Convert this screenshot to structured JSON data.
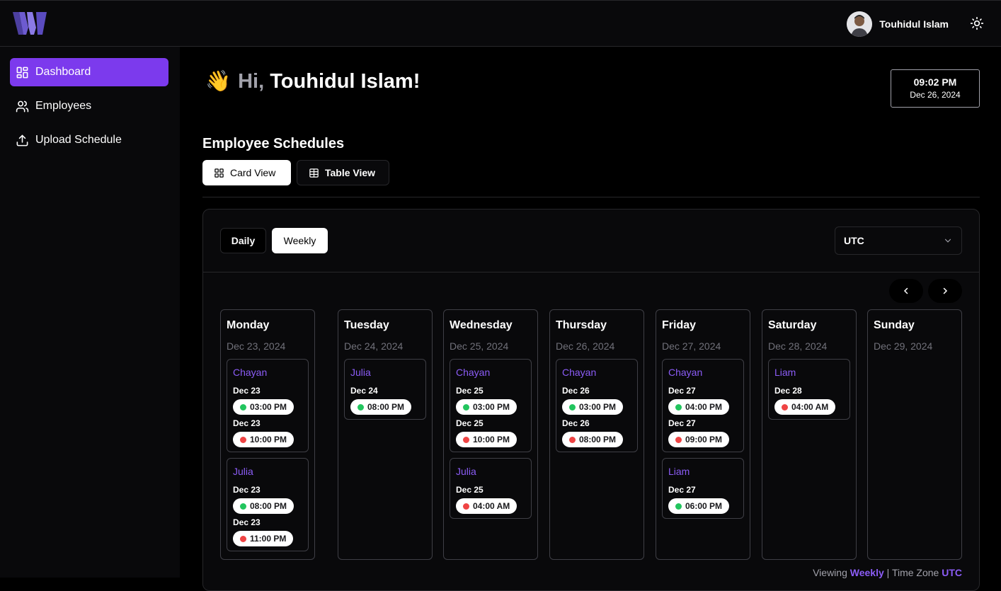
{
  "header": {
    "user_name": "Touhidul Islam",
    "theme_icon": "sun-icon"
  },
  "sidebar": {
    "items": [
      {
        "label": "Dashboard",
        "icon": "dashboard-icon",
        "active": true
      },
      {
        "label": "Employees",
        "icon": "users-icon",
        "active": false
      },
      {
        "label": "Upload Schedule",
        "icon": "upload-icon",
        "active": false
      }
    ]
  },
  "greeting": {
    "emoji": "👋",
    "hi": "Hi,",
    "name": "Touhidul Islam!"
  },
  "clock": {
    "time": "09:02 PM",
    "date": "Dec 26, 2024"
  },
  "schedules": {
    "title": "Employee Schedules",
    "card_view_label": "Card View",
    "table_view_label": "Table View",
    "daily_label": "Daily",
    "weekly_label": "Weekly",
    "timezone": "UTC",
    "footer": {
      "viewing": "Viewing",
      "mode": "Weekly",
      "separator": "|",
      "tz_label": "Time Zone",
      "tz": "UTC"
    },
    "days": [
      {
        "name": "Monday",
        "date": "Dec 23, 2024",
        "employees": [
          {
            "name": "Chayan",
            "shifts": [
              {
                "date": "Dec 23",
                "time": "03:00 PM",
                "type": "in"
              },
              {
                "date": "Dec 23",
                "time": "10:00 PM",
                "type": "out"
              }
            ]
          },
          {
            "name": "Julia",
            "shifts": [
              {
                "date": "Dec 23",
                "time": "08:00 PM",
                "type": "in"
              },
              {
                "date": "Dec 23",
                "time": "11:00 PM",
                "type": "out"
              }
            ]
          }
        ]
      },
      {
        "name": "Tuesday",
        "date": "Dec 24, 2024",
        "employees": [
          {
            "name": "Julia",
            "shifts": [
              {
                "date": "Dec 24",
                "time": "08:00 PM",
                "type": "in"
              }
            ]
          }
        ]
      },
      {
        "name": "Wednesday",
        "date": "Dec 25, 2024",
        "employees": [
          {
            "name": "Chayan",
            "shifts": [
              {
                "date": "Dec 25",
                "time": "03:00 PM",
                "type": "in"
              },
              {
                "date": "Dec 25",
                "time": "10:00 PM",
                "type": "out"
              }
            ]
          },
          {
            "name": "Julia",
            "shifts": [
              {
                "date": "Dec 25",
                "time": "04:00 AM",
                "type": "out"
              }
            ]
          }
        ]
      },
      {
        "name": "Thursday",
        "date": "Dec 26, 2024",
        "employees": [
          {
            "name": "Chayan",
            "shifts": [
              {
                "date": "Dec 26",
                "time": "03:00 PM",
                "type": "in"
              },
              {
                "date": "Dec 26",
                "time": "08:00 PM",
                "type": "out"
              }
            ]
          }
        ]
      },
      {
        "name": "Friday",
        "date": "Dec 27, 2024",
        "employees": [
          {
            "name": "Chayan",
            "shifts": [
              {
                "date": "Dec 27",
                "time": "04:00 PM",
                "type": "in"
              },
              {
                "date": "Dec 27",
                "time": "09:00 PM",
                "type": "out"
              }
            ]
          },
          {
            "name": "Liam",
            "shifts": [
              {
                "date": "Dec 27",
                "time": "06:00 PM",
                "type": "in"
              }
            ]
          }
        ]
      },
      {
        "name": "Saturday",
        "date": "Dec 28, 2024",
        "employees": [
          {
            "name": "Liam",
            "shifts": [
              {
                "date": "Dec 28",
                "time": "04:00 AM",
                "type": "out"
              }
            ]
          }
        ]
      },
      {
        "name": "Sunday",
        "date": "Dec 29, 2024",
        "employees": []
      }
    ]
  }
}
